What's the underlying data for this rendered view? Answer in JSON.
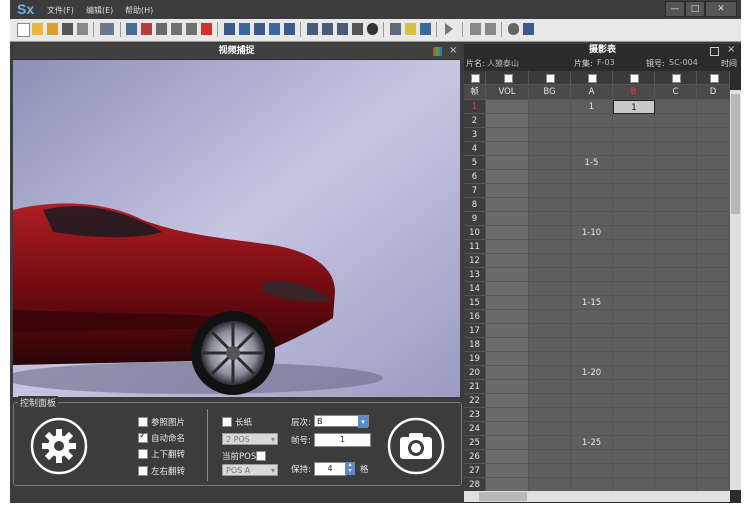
{
  "app": {
    "logo": "Sx",
    "menus": [
      "文件(F)",
      "编辑(E)",
      "帮助(H)"
    ]
  },
  "window_buttons": [
    "—",
    "□",
    "✕"
  ],
  "video": {
    "title": "视频捕捉",
    "close": "×"
  },
  "panel": {
    "title": "控制面板",
    "checkboxes": [
      {
        "label": "参照图片",
        "checked": false
      },
      {
        "label": "自动命名",
        "checked": true
      },
      {
        "label": "上下翻转",
        "checked": false
      },
      {
        "label": "左右翻转",
        "checked": false
      }
    ],
    "long_paper_label": "长纸",
    "pos_select": "2 POS",
    "current_pos_label": "当前POS:",
    "pos_a_select": "POS A",
    "layer_label": "层次:",
    "layer_value": "B",
    "frame_label": "帧号:",
    "frame_value": "1",
    "hold_label": "保持:",
    "hold_value": "4",
    "hold_unit": "格"
  },
  "sheet": {
    "title": "摄影表",
    "info": {
      "film_label": "片名:",
      "film_value": "人猿泰山",
      "episode_label": "片集:",
      "episode_value": "F-03",
      "shot_label": "镜号:",
      "shot_value": "SC-004",
      "time_label": "时间"
    },
    "columns": [
      "帧",
      "VOL",
      "BG",
      "A",
      "B",
      "C",
      "D"
    ],
    "rows": [
      {
        "n": "1",
        "a": "1",
        "b": "1"
      },
      {
        "n": "2",
        "a": "",
        "b": ""
      },
      {
        "n": "3",
        "a": "",
        "b": ""
      },
      {
        "n": "4",
        "a": "",
        "b": ""
      },
      {
        "n": "5",
        "a": "1-5",
        "b": ""
      },
      {
        "n": "6",
        "a": "",
        "b": ""
      },
      {
        "n": "7",
        "a": "",
        "b": ""
      },
      {
        "n": "8",
        "a": "",
        "b": ""
      },
      {
        "n": "9",
        "a": "",
        "b": ""
      },
      {
        "n": "10",
        "a": "1-10",
        "b": ""
      },
      {
        "n": "11",
        "a": "",
        "b": ""
      },
      {
        "n": "12",
        "a": "",
        "b": ""
      },
      {
        "n": "13",
        "a": "",
        "b": ""
      },
      {
        "n": "14",
        "a": "",
        "b": ""
      },
      {
        "n": "15",
        "a": "1-15",
        "b": ""
      },
      {
        "n": "16",
        "a": "",
        "b": ""
      },
      {
        "n": "17",
        "a": "",
        "b": ""
      },
      {
        "n": "18",
        "a": "",
        "b": ""
      },
      {
        "n": "19",
        "a": "",
        "b": ""
      },
      {
        "n": "20",
        "a": "1-20",
        "b": ""
      },
      {
        "n": "21",
        "a": "",
        "b": ""
      },
      {
        "n": "22",
        "a": "",
        "b": ""
      },
      {
        "n": "23",
        "a": "",
        "b": ""
      },
      {
        "n": "24",
        "a": "",
        "b": ""
      },
      {
        "n": "25",
        "a": "1-25",
        "b": ""
      },
      {
        "n": "26",
        "a": "",
        "b": ""
      },
      {
        "n": "27",
        "a": "",
        "b": ""
      },
      {
        "n": "28",
        "a": "",
        "b": ""
      }
    ]
  }
}
